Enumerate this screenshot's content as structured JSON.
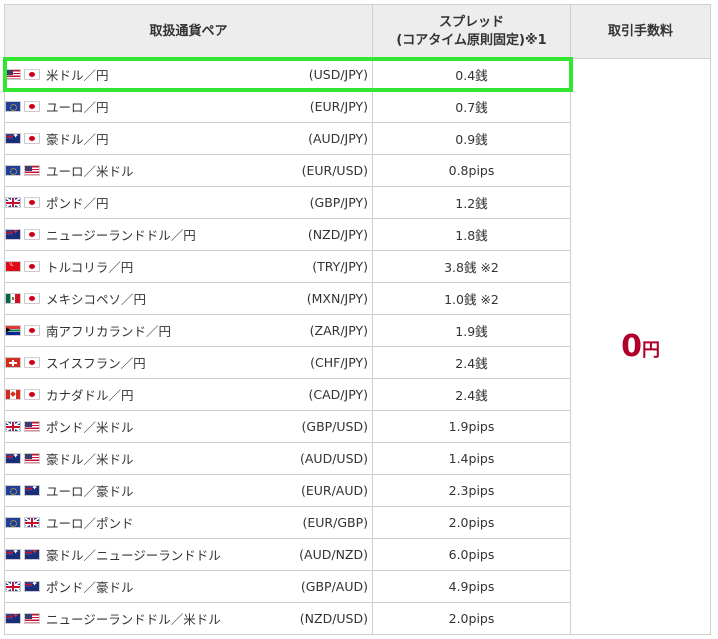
{
  "table": {
    "headers": {
      "pair": "取扱通貨ペア",
      "spread_line1": "スプレッド",
      "spread_line2": "(コアタイム原則固定)※1",
      "fee": "取引手数料"
    },
    "fee": {
      "value": "0",
      "unit": "円"
    },
    "rows": [
      {
        "flags": [
          "us",
          "jp"
        ],
        "name": "米ドル／円",
        "code": "(USD/JPY)",
        "spread": "0.4銭",
        "highlighted": true
      },
      {
        "flags": [
          "eu",
          "jp"
        ],
        "name": "ユーロ／円",
        "code": "(EUR/JPY)",
        "spread": "0.7銭"
      },
      {
        "flags": [
          "au",
          "jp"
        ],
        "name": "豪ドル／円",
        "code": "(AUD/JPY)",
        "spread": "0.9銭"
      },
      {
        "flags": [
          "eu",
          "us"
        ],
        "name": "ユーロ／米ドル",
        "code": "(EUR/USD)",
        "spread": "0.8pips"
      },
      {
        "flags": [
          "gb",
          "jp"
        ],
        "name": "ポンド／円",
        "code": "(GBP/JPY)",
        "spread": "1.2銭"
      },
      {
        "flags": [
          "nz",
          "jp"
        ],
        "name": "ニュージーランドドル／円",
        "code": "(NZD/JPY)",
        "spread": "1.8銭"
      },
      {
        "flags": [
          "tr",
          "jp"
        ],
        "name": "トルコリラ／円",
        "code": "(TRY/JPY)",
        "spread": "3.8銭 ※2"
      },
      {
        "flags": [
          "mx",
          "jp"
        ],
        "name": "メキシコペソ／円",
        "code": "(MXN/JPY)",
        "spread": "1.0銭 ※2"
      },
      {
        "flags": [
          "za",
          "jp"
        ],
        "name": "南アフリカランド／円",
        "code": "(ZAR/JPY)",
        "spread": "1.9銭"
      },
      {
        "flags": [
          "ch",
          "jp"
        ],
        "name": "スイスフラン／円",
        "code": "(CHF/JPY)",
        "spread": "2.4銭"
      },
      {
        "flags": [
          "ca",
          "jp"
        ],
        "name": "カナダドル／円",
        "code": "(CAD/JPY)",
        "spread": "2.4銭"
      },
      {
        "flags": [
          "gb",
          "us"
        ],
        "name": "ポンド／米ドル",
        "code": "(GBP/USD)",
        "spread": "1.9pips"
      },
      {
        "flags": [
          "au",
          "us"
        ],
        "name": "豪ドル／米ドル",
        "code": "(AUD/USD)",
        "spread": "1.4pips"
      },
      {
        "flags": [
          "eu",
          "au"
        ],
        "name": "ユーロ／豪ドル",
        "code": "(EUR/AUD)",
        "spread": "2.3pips"
      },
      {
        "flags": [
          "eu",
          "gb"
        ],
        "name": "ユーロ／ポンド",
        "code": "(EUR/GBP)",
        "spread": "2.0pips"
      },
      {
        "flags": [
          "au",
          "nz"
        ],
        "name": "豪ドル／ニュージーランドドル",
        "code": "(AUD/NZD)",
        "spread": "6.0pips"
      },
      {
        "flags": [
          "gb",
          "au"
        ],
        "name": "ポンド／豪ドル",
        "code": "(GBP/AUD)",
        "spread": "4.9pips"
      },
      {
        "flags": [
          "nz",
          "us"
        ],
        "name": "ニュージーランドドル／米ドル",
        "code": "(NZD/USD)",
        "spread": "2.0pips"
      }
    ]
  },
  "colors": {
    "highlight": "#33e633",
    "fee_text": "#b0002a",
    "header_bg": "#ededed",
    "border": "#cfcfcf"
  }
}
